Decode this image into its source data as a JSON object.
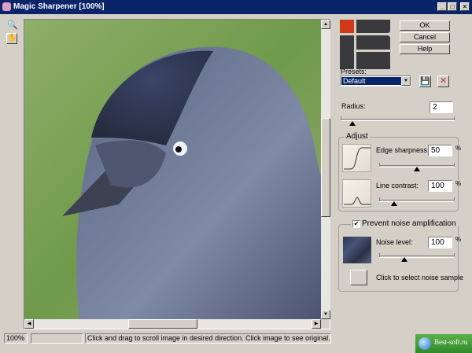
{
  "window": {
    "title": "Magic Sharpener [100%]",
    "minimize": "_",
    "maximize": "□",
    "close": "×"
  },
  "tools": {
    "zoom": "zoom-icon",
    "hand": "hand-icon"
  },
  "buttons": {
    "ok": "OK",
    "cancel": "Cancel",
    "help": "Help"
  },
  "presets": {
    "label": "Presets:",
    "selected": "Default",
    "save": "save-icon",
    "delete": "delete-icon"
  },
  "radius": {
    "label": "Radius:",
    "value": "2",
    "slider_fraction": 0.1
  },
  "adjust": {
    "title": "Adjust",
    "edge": {
      "label": "Edge sharpness:",
      "value": "50",
      "unit": "%",
      "slider_fraction": 0.5
    },
    "line": {
      "label": "Line contrast:",
      "value": "100",
      "unit": "%",
      "slider_fraction": 0.2
    }
  },
  "noise": {
    "title": "Prevent noise amplification",
    "checked": true,
    "label": "Noise level:",
    "value": "100",
    "unit": "%",
    "slider_fraction": 0.33,
    "sample_text": "Click to select noise sample"
  },
  "status": {
    "zoom": "100%",
    "progress": "",
    "message": "Click and drag to scroll image in desired direction. Click image to see original."
  },
  "watermark": {
    "text": "Best-soft.ru"
  },
  "colors": {
    "titlebar": "#0a246a",
    "logo_accent": "#d03a1a",
    "logo_dark": "#3a3a3c"
  }
}
